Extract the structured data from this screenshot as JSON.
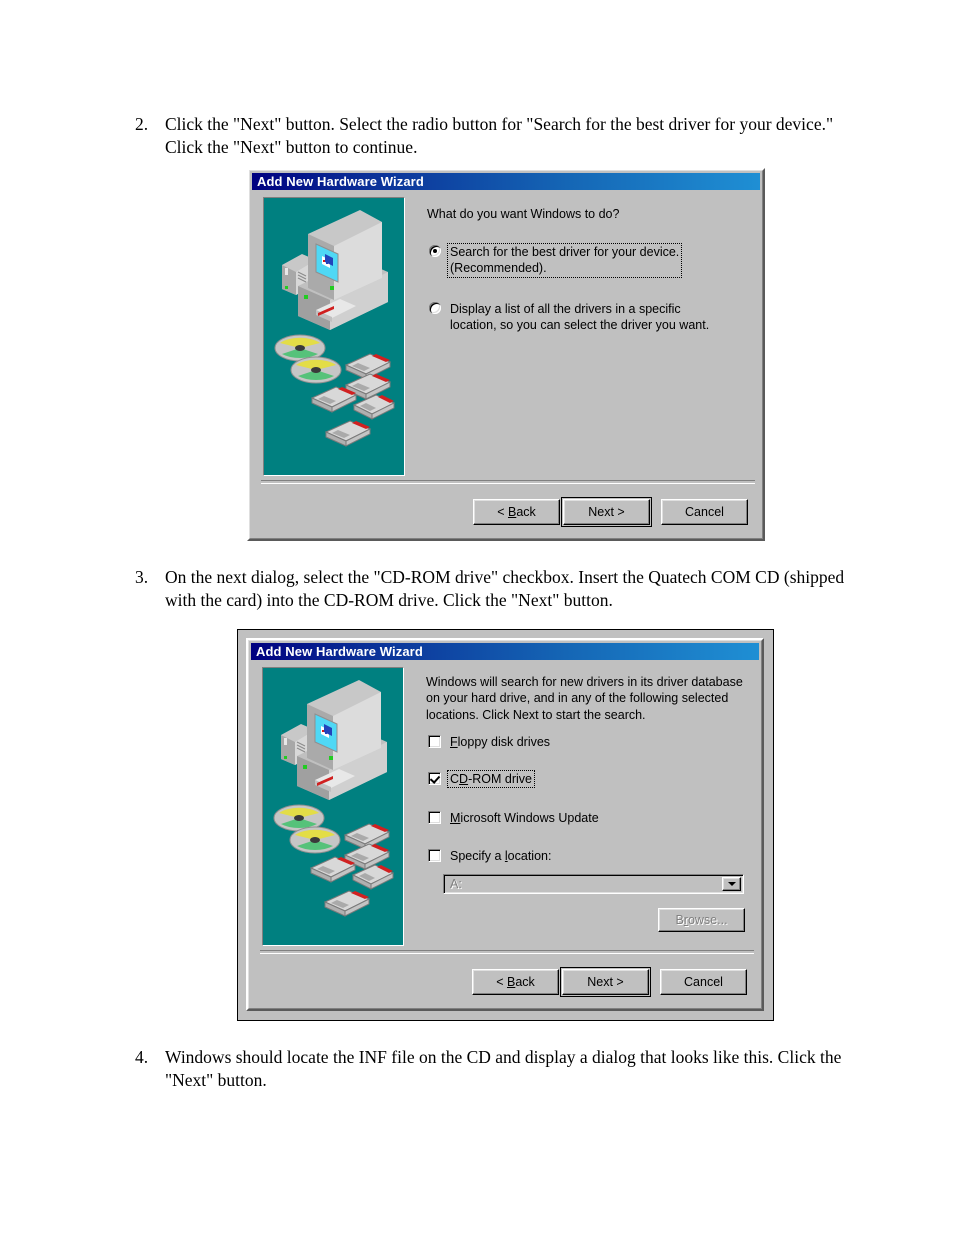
{
  "document": {
    "steps": [
      {
        "number": "2.",
        "text": "Click the \"Next\" button.  Select the radio button for \"Search for the best driver for your device.\"  Click the \"Next\" button to continue."
      },
      {
        "number": "3.",
        "text": "On the next dialog, select the \"CD-ROM drive\" checkbox.  Insert the Quatech COM CD (shipped with the card) into the CD-ROM drive.  Click the \"Next\" button."
      },
      {
        "number": "4.",
        "text": "Windows should locate the INF file on the CD and display a dialog that looks like this.  Click the \"Next\" button."
      }
    ]
  },
  "dialog1": {
    "title": "Add New Hardware Wizard",
    "prompt": "What do you want Windows to do?",
    "options": [
      {
        "line1": "Search for the best driver for your device.",
        "line2": "(Recommended).",
        "selected": true,
        "focused": true
      },
      {
        "line1": "Display a list of all the drivers in a specific",
        "line2": "location, so you can select the driver you want.",
        "selected": false,
        "focused": false
      }
    ],
    "buttons": {
      "back": "< Back",
      "back_accel": "B",
      "next": "Next >",
      "cancel": "Cancel"
    }
  },
  "dialog2": {
    "title": "Add New Hardware Wizard",
    "body_line1": "Windows will search for new drivers in its driver database",
    "body_line2": "on your hard drive, and in any of the following selected",
    "body_line3": "locations. Click Next to start the search.",
    "checkboxes": [
      {
        "accel": "F",
        "rest": "loppy disk drives",
        "checked": false,
        "focused": false,
        "disabled": false
      },
      {
        "accel": "D",
        "pre": "C",
        "rest": "-ROM drive",
        "checked": true,
        "focused": true,
        "disabled": false
      },
      {
        "accel": "M",
        "rest": "icrosoft Windows Update",
        "checked": false,
        "focused": false,
        "disabled": false
      },
      {
        "accel": "l",
        "pre": "Specify a ",
        "rest": "ocation:",
        "checked": false,
        "focused": false,
        "disabled": false
      }
    ],
    "location_value": "A:",
    "browse_label": "Browse...",
    "browse_accel": "r",
    "buttons": {
      "back": "< Back",
      "back_accel": "B",
      "next": "Next >",
      "cancel": "Cancel"
    }
  },
  "colors": {
    "titlebar_start": "#000080",
    "titlebar_end": "#1f8fd4",
    "dialog_face": "#c0c0c0",
    "illustration_bg": "#008080",
    "screen_cyan": "#4fd8f5",
    "disabled_text": "#808080"
  }
}
